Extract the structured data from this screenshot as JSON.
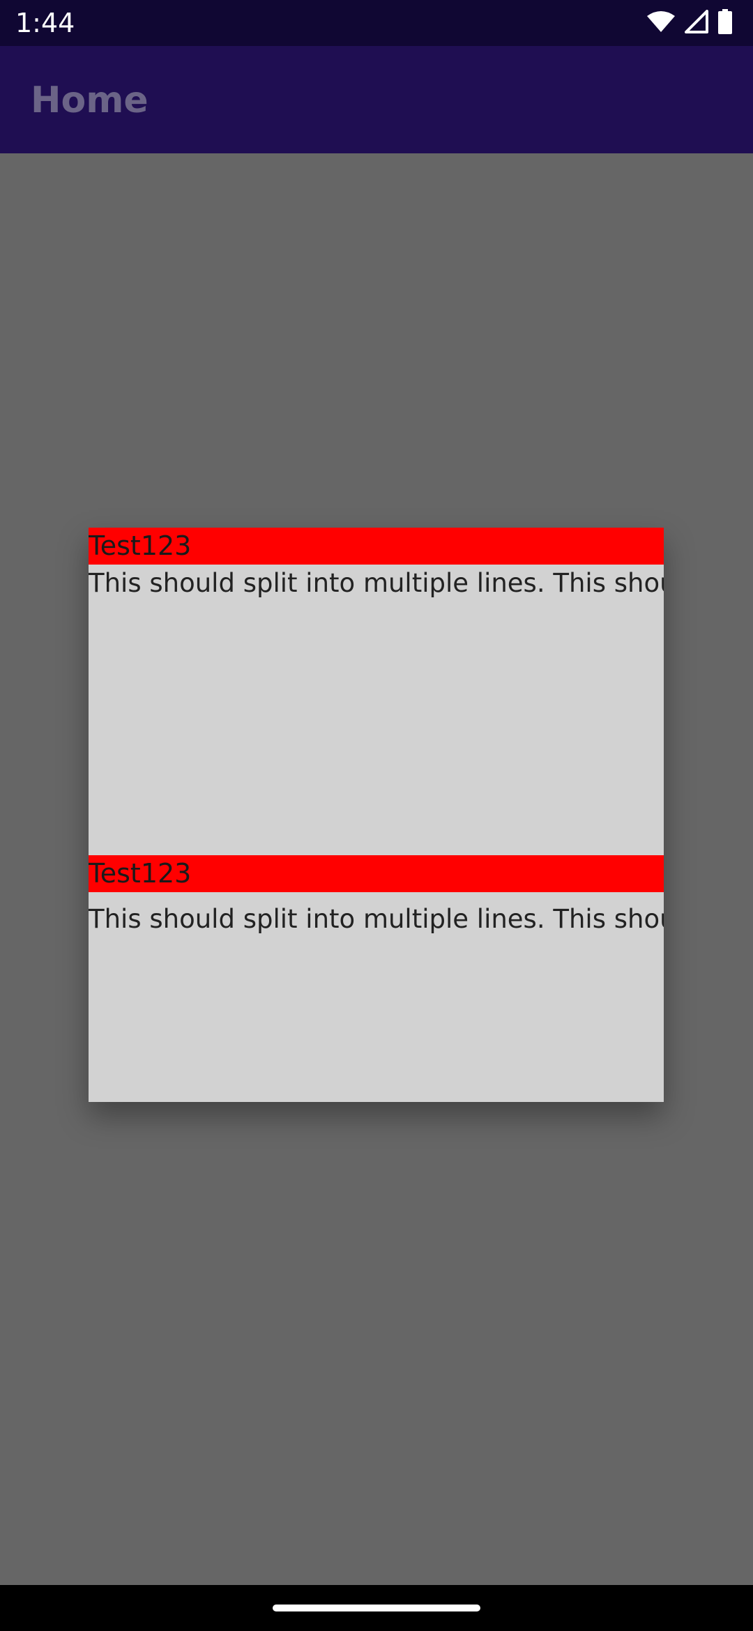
{
  "status_bar": {
    "time": "1:44",
    "icons": [
      "wifi-icon",
      "cell-signal-icon",
      "battery-icon"
    ]
  },
  "app_bar": {
    "title": "Home"
  },
  "dialog": {
    "items": [
      {
        "header": "Test123",
        "body": "This should split into multiple lines. This should split into multiple lines."
      },
      {
        "header": "Test123",
        "body": "This should split into multiple lines. This should split into multiple lines."
      }
    ]
  },
  "colors": {
    "status_bar_bg": "#100733",
    "app_bar_bg": "#1f0e52",
    "scrim": "#666666",
    "dialog_bg": "#d2d2d2",
    "header_bg": "#ff0000"
  }
}
